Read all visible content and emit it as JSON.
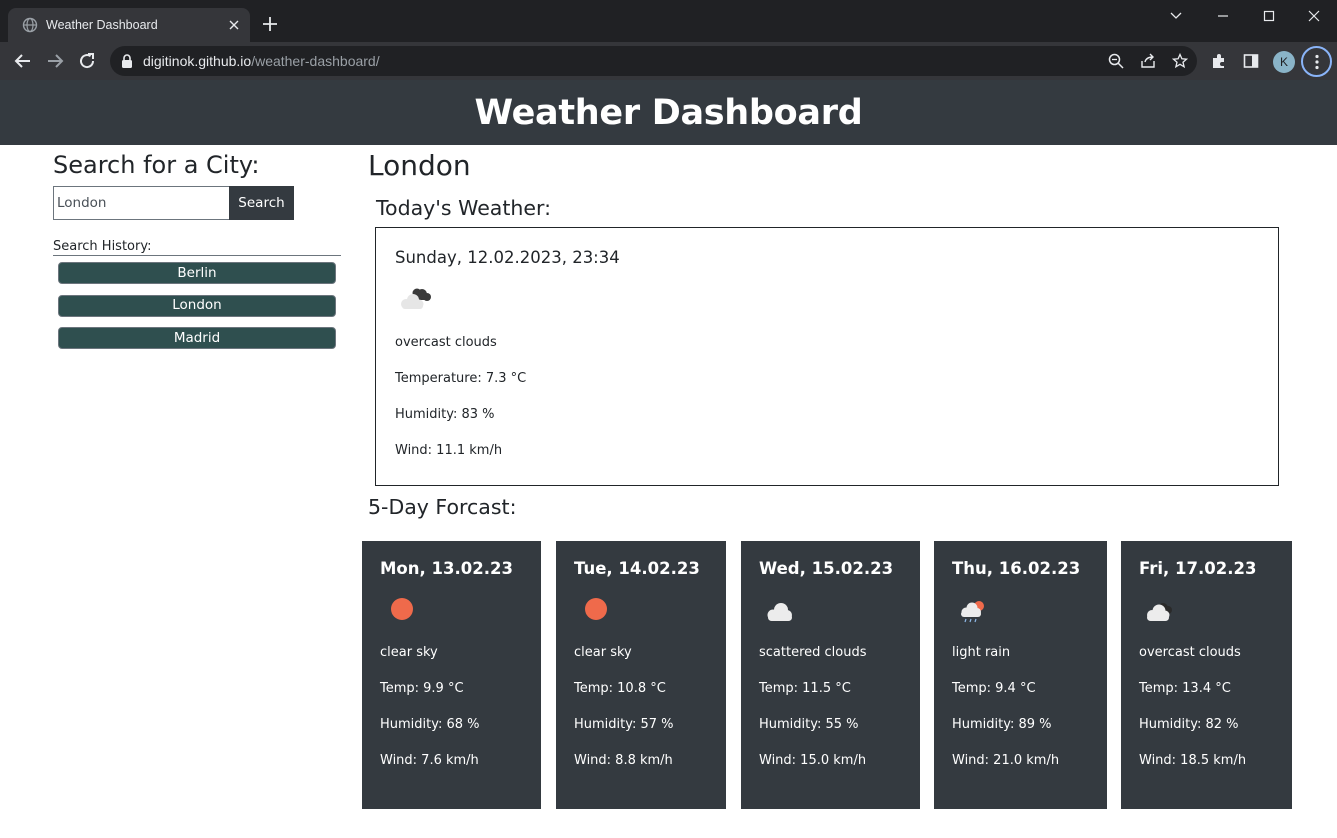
{
  "browser": {
    "tab_title": "Weather Dashboard",
    "url_host": "digitinok.github.io",
    "url_path": "/weather-dashboard/",
    "profile_initial": "K"
  },
  "header": {
    "title": "Weather Dashboard"
  },
  "sidebar": {
    "heading": "Search for a City:",
    "search_value": "London",
    "search_button": "Search",
    "history_label": "Search History:",
    "history": [
      {
        "label": "Berlin"
      },
      {
        "label": "London"
      },
      {
        "label": "Madrid"
      }
    ]
  },
  "main": {
    "city": "London",
    "today_heading": "Today's Weather:",
    "today": {
      "date": "Sunday, 12.02.2023, 23:34",
      "icon": "overcast-clouds-icon",
      "description": "overcast clouds",
      "temperature": "Temperature: 7.3 °C",
      "humidity": "Humidity: 83 %",
      "wind": "Wind: 11.1 km/h"
    },
    "forecast_heading": "5-Day Forcast:",
    "forecast": [
      {
        "date": "Mon, 13.02.23",
        "icon": "clear-sky-icon",
        "description": "clear sky",
        "temp": "Temp: 9.9 °C",
        "humidity": "Humidity: 68 %",
        "wind": "Wind: 7.6 km/h"
      },
      {
        "date": "Tue, 14.02.23",
        "icon": "clear-sky-icon",
        "description": "clear sky",
        "temp": "Temp: 10.8 °C",
        "humidity": "Humidity: 57 %",
        "wind": "Wind: 8.8 km/h"
      },
      {
        "date": "Wed, 15.02.23",
        "icon": "scattered-clouds-icon",
        "description": "scattered clouds",
        "temp": "Temp: 11.5 °C",
        "humidity": "Humidity: 55 %",
        "wind": "Wind: 15.0 km/h"
      },
      {
        "date": "Thu, 16.02.23",
        "icon": "light-rain-icon",
        "description": "light rain",
        "temp": "Temp: 9.4 °C",
        "humidity": "Humidity: 89 %",
        "wind": "Wind: 21.0 km/h"
      },
      {
        "date": "Fri, 17.02.23",
        "icon": "overcast-clouds-icon",
        "description": "overcast clouds",
        "temp": "Temp: 13.4 °C",
        "humidity": "Humidity: 82 %",
        "wind": "Wind: 18.5 km/h"
      }
    ]
  },
  "colors": {
    "header_bg": "#343a40",
    "card_bg": "#343a40",
    "history_btn_bg": "#2f4f4f",
    "sun": "#ef6a4b"
  }
}
